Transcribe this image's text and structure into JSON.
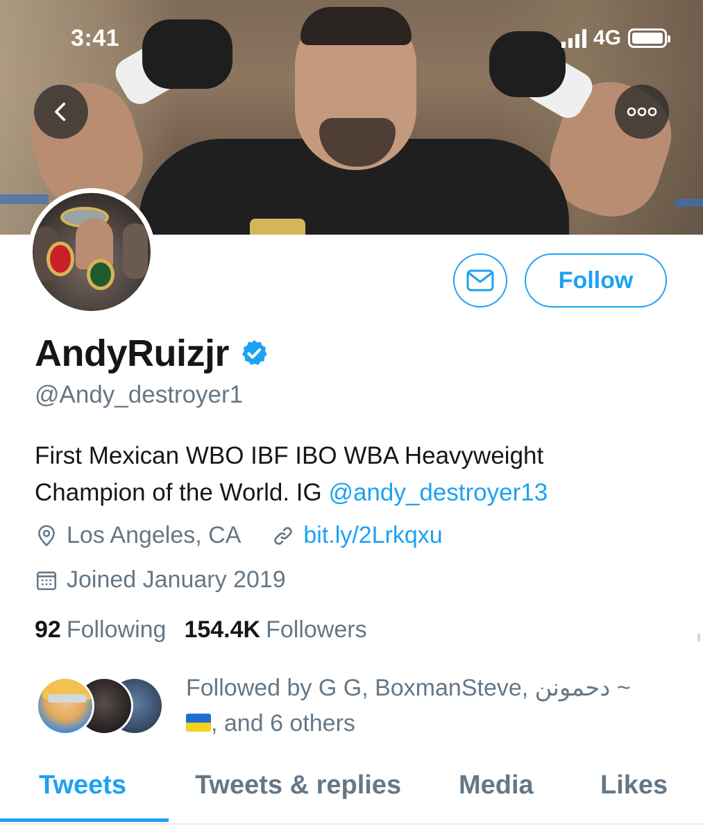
{
  "status_bar": {
    "time": "3:41",
    "network": "4G",
    "battery_level": 1.0,
    "signal_bars": 4
  },
  "header": {
    "back_icon": "chevron-left-icon",
    "more_icon": "more-horizontal-icon"
  },
  "actions": {
    "message_icon": "mail-icon",
    "follow_label": "Follow"
  },
  "profile": {
    "display_name": "AndyRuizjr",
    "verified": true,
    "handle": "@Andy_destroyer1",
    "bio_text": "First Mexican WBO IBF IBO WBA Heavyweight Champion of the World. IG ",
    "bio_mention": "@andy_destroyer13",
    "location": "Los Angeles, CA",
    "website": "bit.ly/2Lrkqxu",
    "joined": "Joined January 2019"
  },
  "stats": {
    "following_count": "92",
    "following_label": "Following",
    "followers_count": "154.4K",
    "followers_label": "Followers"
  },
  "followed_by": {
    "prefix": "Followed by G G, BoxmanSteve, دحمونن ~",
    "suffix": ", and 6 others"
  },
  "tabs": {
    "items": [
      {
        "label": "Tweets",
        "active": true
      },
      {
        "label": "Tweets & replies",
        "active": false
      },
      {
        "label": "Media",
        "active": false
      },
      {
        "label": "Likes",
        "active": false
      }
    ]
  },
  "colors": {
    "accent": "#1da1f2",
    "text_primary": "#14171a",
    "text_secondary": "#657786"
  }
}
